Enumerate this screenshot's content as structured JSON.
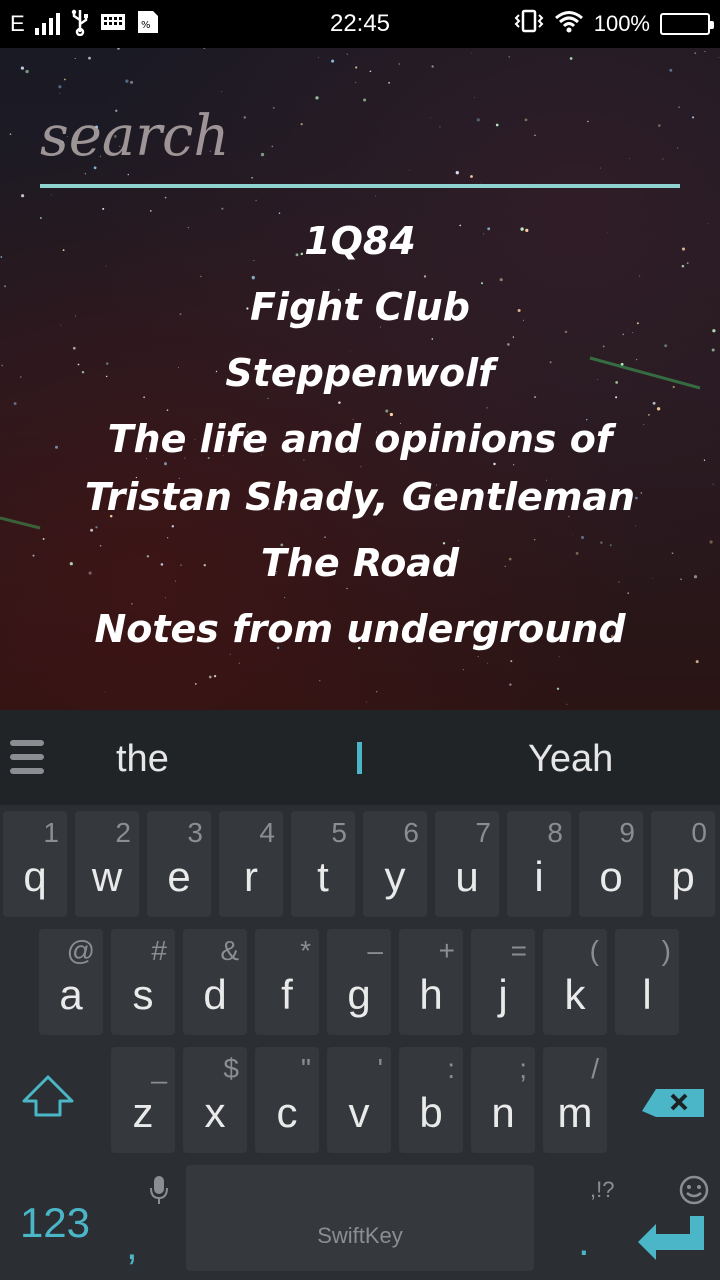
{
  "status_bar": {
    "network": "E",
    "time": "22:45",
    "battery": "100%",
    "icons": [
      "signal-icon",
      "usb-icon",
      "keyboard-icon",
      "sim-icon",
      "vibrate-icon",
      "wifi-icon",
      "battery-icon"
    ]
  },
  "search": {
    "placeholder": "search",
    "value": ""
  },
  "results": [
    "1Q84",
    "Fight Club",
    "Steppenwolf",
    "The life and opinions of Tristan Shady, Gentleman",
    "The Road",
    "Notes from underground"
  ],
  "keyboard": {
    "suggestions": {
      "left": "the",
      "middle": "I",
      "right": "Yeah"
    },
    "row1": [
      {
        "p": "q",
        "s": "1"
      },
      {
        "p": "w",
        "s": "2"
      },
      {
        "p": "e",
        "s": "3"
      },
      {
        "p": "r",
        "s": "4"
      },
      {
        "p": "t",
        "s": "5"
      },
      {
        "p": "y",
        "s": "6"
      },
      {
        "p": "u",
        "s": "7"
      },
      {
        "p": "i",
        "s": "8"
      },
      {
        "p": "o",
        "s": "9"
      },
      {
        "p": "p",
        "s": "0"
      }
    ],
    "row2": [
      {
        "p": "a",
        "s": "@"
      },
      {
        "p": "s",
        "s": "#"
      },
      {
        "p": "d",
        "s": "&"
      },
      {
        "p": "f",
        "s": "*"
      },
      {
        "p": "g",
        "s": "–"
      },
      {
        "p": "h",
        "s": "+"
      },
      {
        "p": "j",
        "s": "="
      },
      {
        "p": "k",
        "s": "("
      },
      {
        "p": "l",
        "s": ")"
      }
    ],
    "row3": [
      {
        "p": "z",
        "s": "_"
      },
      {
        "p": "x",
        "s": "$"
      },
      {
        "p": "c",
        "s": "\""
      },
      {
        "p": "v",
        "s": "'"
      },
      {
        "p": "b",
        "s": ":"
      },
      {
        "p": "n",
        "s": ";"
      },
      {
        "p": "m",
        "s": "/"
      }
    ],
    "numbers_label": "123",
    "comma": ",",
    "space_brand": "SwiftKey",
    "period_symbols": ",!?",
    "period": ".",
    "accent_color": "#4ab6c8"
  }
}
